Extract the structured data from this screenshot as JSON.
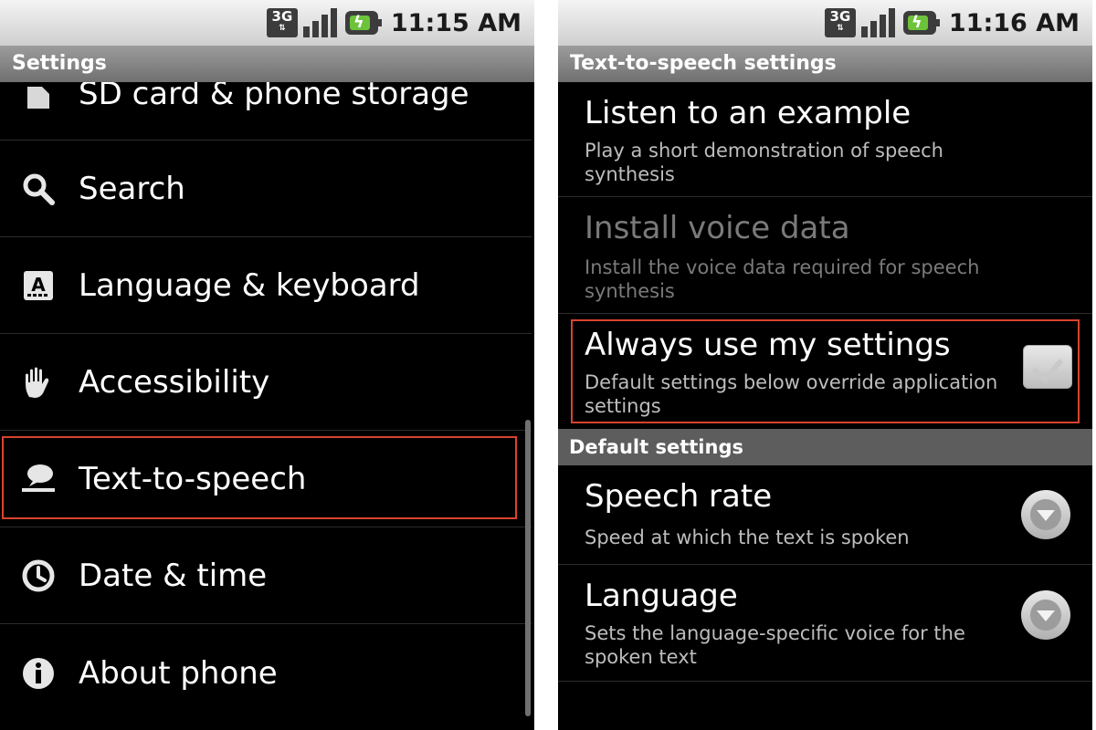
{
  "left": {
    "status": {
      "network": "3G",
      "time": "11:15 AM"
    },
    "title": "Settings",
    "items": [
      {
        "label": "SD card & phone storage",
        "icon": "sd-card-icon"
      },
      {
        "label": "Search",
        "icon": "search-icon"
      },
      {
        "label": "Language & keyboard",
        "icon": "language-keyboard-icon"
      },
      {
        "label": "Accessibility",
        "icon": "hand-icon"
      },
      {
        "label": "Text-to-speech",
        "icon": "speech-icon"
      },
      {
        "label": "Date & time",
        "icon": "clock-icon"
      },
      {
        "label": "About phone",
        "icon": "info-icon"
      }
    ]
  },
  "right": {
    "status": {
      "network": "3G",
      "time": "11:16 AM"
    },
    "title": "Text-to-speech settings",
    "prefs": [
      {
        "title": "Listen to an example",
        "summary": "Play a short demonstration of speech synthesis"
      },
      {
        "title": "Install voice data",
        "summary": "Install the voice data required for speech synthesis",
        "enabled": false
      },
      {
        "title": "Always use my settings",
        "summary": "Default settings below override application settings",
        "checked": true
      }
    ],
    "section": "Default settings",
    "defaults": [
      {
        "title": "Speech rate",
        "summary": "Speed at which the text is spoken"
      },
      {
        "title": "Language",
        "summary": "Sets the language-specific voice for the spoken text"
      }
    ]
  },
  "colors": {
    "highlight": "#d8432f",
    "battery": "#6cc33a",
    "background": "#000000"
  }
}
